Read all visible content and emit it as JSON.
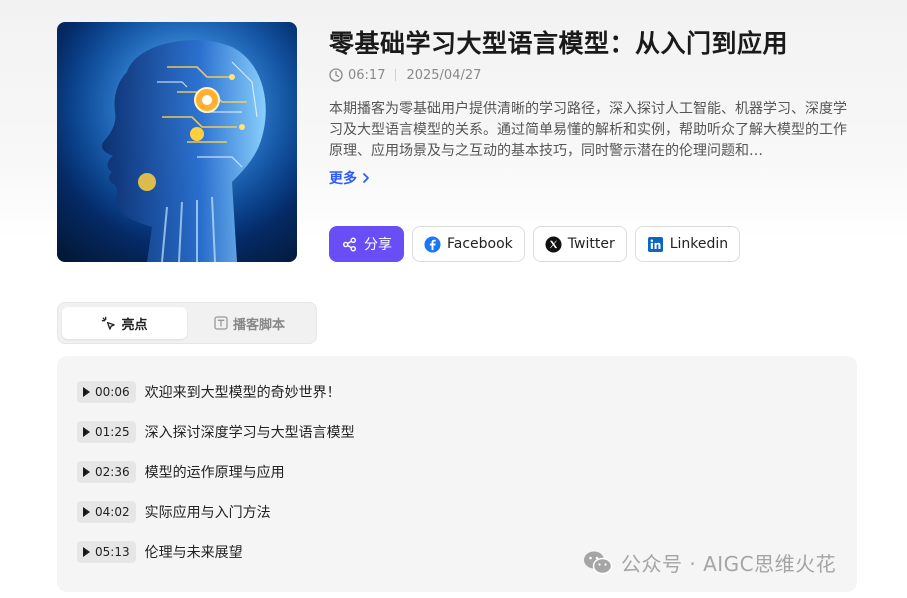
{
  "episode": {
    "title": "零基础学习大型语言模型：从入门到应用",
    "duration": "06:17",
    "date": "2025/04/27",
    "description": "本期播客为零基础用户提供清晰的学习路径，深入探讨人工智能、机器学习、深度学习及大型语言模型的关系。通过简单易懂的解析和实例，帮助听众了解大模型的工作原理、应用场景及与之互动的基本技巧，同时警示潜在的伦理问题和…",
    "more_label": "更多"
  },
  "share_buttons": [
    {
      "label": "分享",
      "icon": "share-icon"
    },
    {
      "label": "Facebook",
      "icon": "facebook-icon"
    },
    {
      "label": "Twitter",
      "icon": "x-twitter-icon"
    },
    {
      "label": "Linkedin",
      "icon": "linkedin-icon"
    }
  ],
  "tabs": [
    {
      "label": "亮点",
      "icon": "sparkle-cursor-icon",
      "active": true
    },
    {
      "label": "播客脚本",
      "icon": "text-box-icon",
      "active": false
    }
  ],
  "chapters": [
    {
      "time": "00:06",
      "title": "欢迎来到大型模型的奇妙世界！"
    },
    {
      "time": "01:25",
      "title": "深入探讨深度学习与大型语言模型"
    },
    {
      "time": "02:36",
      "title": "模型的运作原理与应用"
    },
    {
      "time": "04:02",
      "title": "实际应用与入门方法"
    },
    {
      "time": "05:13",
      "title": "伦理与未来展望"
    }
  ],
  "watermark": {
    "text": "公众号 · AIGC思维火花",
    "icon": "wechat-icon"
  },
  "colors": {
    "accent": "#6a4ef5",
    "link": "#2e5bff",
    "facebook": "#1877f2",
    "linkedin": "#0a66c2"
  }
}
